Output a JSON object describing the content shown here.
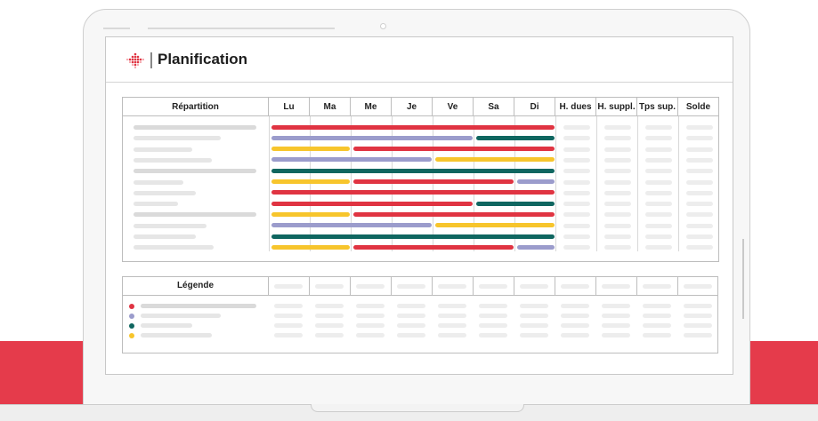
{
  "app": {
    "title": "Planification"
  },
  "colors": {
    "red": "#e03442",
    "lavender": "#9b9ccc",
    "teal": "#0f6660",
    "yellow": "#f7c52c",
    "background_band": "#e53b4b"
  },
  "table": {
    "columns": [
      "Répartition",
      "Lu",
      "Ma",
      "Me",
      "Je",
      "Ve",
      "Sa",
      "Di",
      "H. dues",
      "H. suppl.",
      "Tps sup.",
      "Solde"
    ],
    "rows": [
      {
        "segments": [
          {
            "from": 0,
            "to": 7,
            "color": "red"
          }
        ]
      },
      {
        "segments": [
          {
            "from": 0,
            "to": 5,
            "color": "lavender"
          },
          {
            "from": 5,
            "to": 7,
            "color": "teal"
          }
        ]
      },
      {
        "segments": [
          {
            "from": 0,
            "to": 2,
            "color": "yellow"
          },
          {
            "from": 2,
            "to": 7,
            "color": "red"
          }
        ]
      },
      {
        "segments": [
          {
            "from": 0,
            "to": 4,
            "color": "lavender"
          },
          {
            "from": 4,
            "to": 7,
            "color": "yellow"
          }
        ]
      },
      {
        "segments": [
          {
            "from": 0,
            "to": 7,
            "color": "teal"
          }
        ]
      },
      {
        "segments": [
          {
            "from": 0,
            "to": 2,
            "color": "yellow"
          },
          {
            "from": 2,
            "to": 6,
            "color": "red"
          },
          {
            "from": 6,
            "to": 7,
            "color": "lavender"
          }
        ]
      },
      {
        "segments": [
          {
            "from": 0,
            "to": 7,
            "color": "red"
          }
        ]
      },
      {
        "segments": [
          {
            "from": 0,
            "to": 5,
            "color": "red"
          },
          {
            "from": 5,
            "to": 7,
            "color": "teal"
          }
        ]
      },
      {
        "segments": [
          {
            "from": 0,
            "to": 2,
            "color": "yellow"
          },
          {
            "from": 2,
            "to": 7,
            "color": "red"
          }
        ]
      },
      {
        "segments": [
          {
            "from": 0,
            "to": 4,
            "color": "lavender"
          },
          {
            "from": 4,
            "to": 7,
            "color": "yellow"
          }
        ]
      },
      {
        "segments": [
          {
            "from": 0,
            "to": 7,
            "color": "teal"
          }
        ]
      },
      {
        "segments": [
          {
            "from": 0,
            "to": 2,
            "color": "yellow"
          },
          {
            "from": 2,
            "to": 6,
            "color": "red"
          },
          {
            "from": 6,
            "to": 7,
            "color": "lavender"
          }
        ]
      }
    ]
  },
  "legend": {
    "title": "Légende",
    "items": [
      {
        "color": "red"
      },
      {
        "color": "lavender"
      },
      {
        "color": "teal"
      },
      {
        "color": "yellow"
      }
    ]
  }
}
